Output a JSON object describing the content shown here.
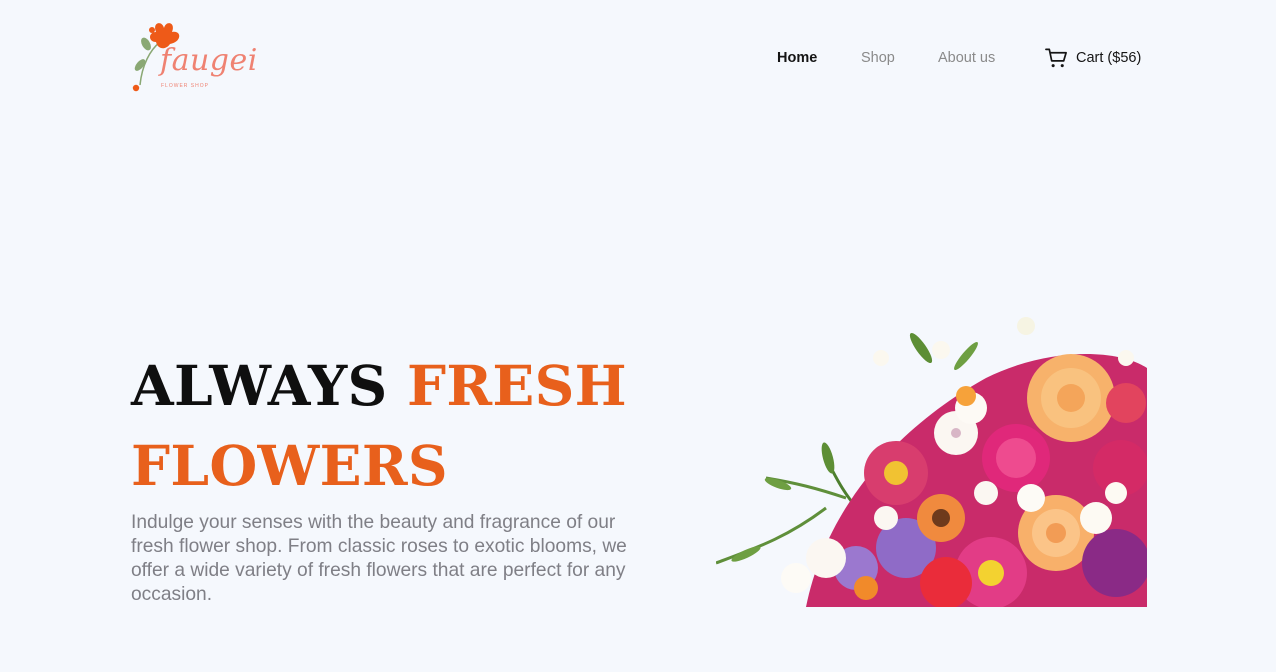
{
  "brand": {
    "name": "faugei",
    "tagline": "FLOWER SHOP",
    "colors": {
      "logo_pink": "#ef8272",
      "logo_orange": "#ee5a18",
      "logo_leaf": "#8aa874"
    }
  },
  "nav": {
    "items": [
      {
        "label": "Home",
        "active": true
      },
      {
        "label": "Shop",
        "active": false
      },
      {
        "label": "About us",
        "active": false
      }
    ],
    "cart": {
      "icon": "cart-icon",
      "label": "Cart ($56)"
    }
  },
  "hero": {
    "title_part1": "ALWAYS",
    "title_part2": "FRESH",
    "title_part3": "FLOWERS",
    "description": "Indulge your senses with the beauty and fragrance of our fresh flower shop. From classic roses to exotic blooms, we offer a wide variety of fresh flowers that are perfect for any occasion.",
    "image": "flower-bouquet-image"
  },
  "colors": {
    "background": "#f5f8fd",
    "accent": "#e8601c",
    "heading": "#0f0f0f",
    "body_text": "#7f7f86",
    "nav_inactive": "#8a8a8a"
  }
}
